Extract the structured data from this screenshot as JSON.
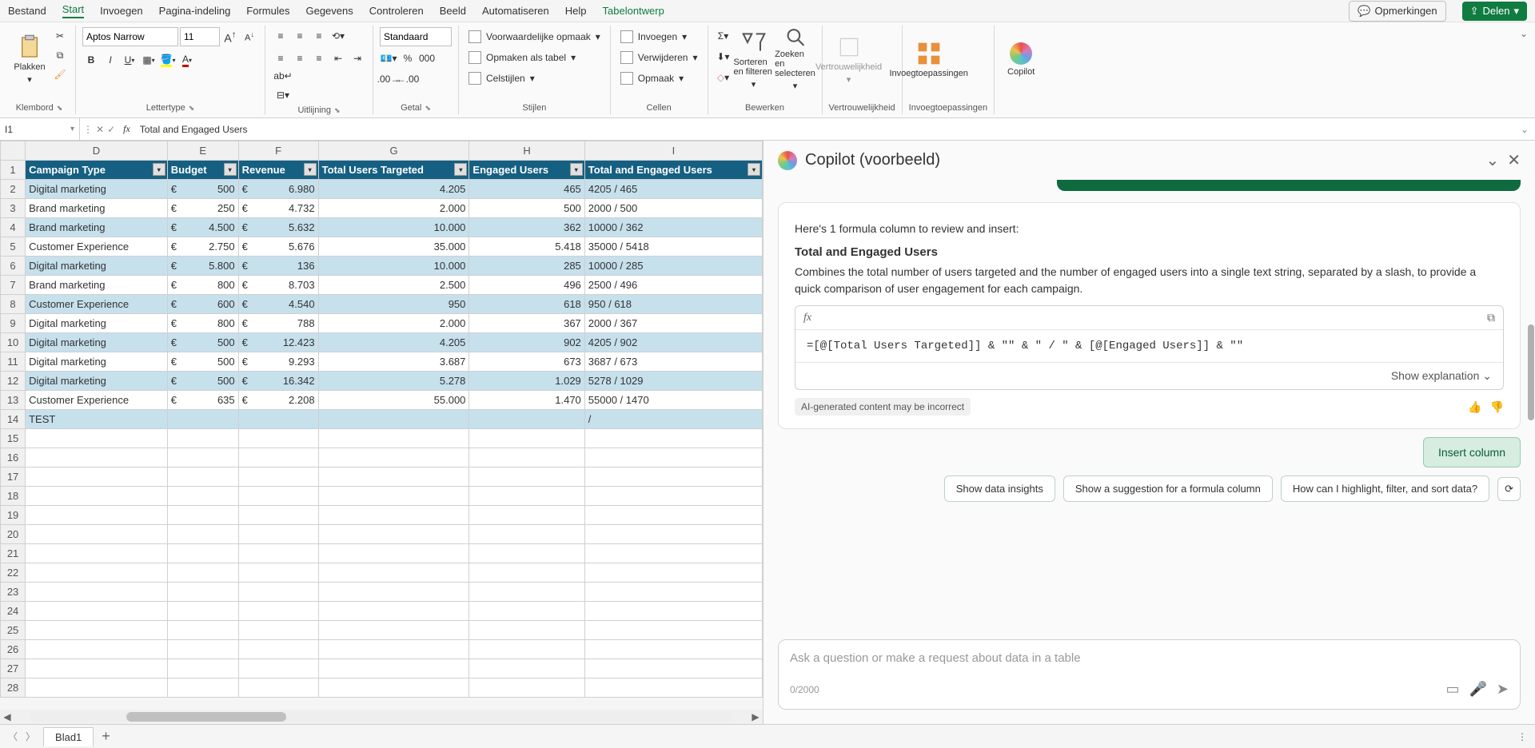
{
  "menu": [
    "Bestand",
    "Start",
    "Invoegen",
    "Pagina-indeling",
    "Formules",
    "Gegevens",
    "Controleren",
    "Beeld",
    "Automatiseren",
    "Help",
    "Tabelontwerp"
  ],
  "active_menu": 1,
  "special_menu": 10,
  "opmerkingen": "Opmerkingen",
  "delen": "Delen",
  "ribbon": {
    "plakken": "Plakken",
    "klembord": "Klembord",
    "font_name": "Aptos Narrow",
    "font_size": "11",
    "lettertype": "Lettertype",
    "uitlijning": "Uitlijning",
    "getal": "Getal",
    "num_format": "Standaard",
    "cond_fmt": "Voorwaardelijke opmaak",
    "fmt_table": "Opmaken als tabel",
    "celstijlen": "Celstijlen",
    "stijlen": "Stijlen",
    "invoegen": "Invoegen",
    "verwijderen": "Verwijderen",
    "opmaak": "Opmaak",
    "cellen": "Cellen",
    "sort_filter": "Sorteren en filteren",
    "find_select": "Zoeken en selecteren",
    "bewerken": "Bewerken",
    "vertrouw": "Vertrouwelijkheid",
    "addins": "Invoegtoepassingen",
    "copilot": "Copilot",
    "pct": "%",
    "zeros": "000"
  },
  "namebox": "I1",
  "formula": "Total and Engaged Users",
  "cols": [
    "D",
    "E",
    "F",
    "G",
    "H",
    "I"
  ],
  "headers": [
    "Campaign Type",
    "Budget",
    "Revenue",
    "Total Users Targeted",
    "Engaged Users",
    "Total and Engaged Users"
  ],
  "rows": [
    {
      "n": 2,
      "ct": "Digital marketing",
      "b": "500",
      "r": "6.980",
      "tt": "4.205",
      "eu": "465",
      "te": "4205 / 465"
    },
    {
      "n": 3,
      "ct": "Brand marketing",
      "b": "250",
      "r": "4.732",
      "tt": "2.000",
      "eu": "500",
      "te": "2000 / 500"
    },
    {
      "n": 4,
      "ct": "Brand marketing",
      "b": "4.500",
      "r": "5.632",
      "tt": "10.000",
      "eu": "362",
      "te": "10000 / 362"
    },
    {
      "n": 5,
      "ct": "Customer Experience",
      "b": "2.750",
      "r": "5.676",
      "tt": "35.000",
      "eu": "5.418",
      "te": "35000 / 5418"
    },
    {
      "n": 6,
      "ct": "Digital marketing",
      "b": "5.800",
      "r": "136",
      "tt": "10.000",
      "eu": "285",
      "te": "10000 / 285"
    },
    {
      "n": 7,
      "ct": "Brand marketing",
      "b": "800",
      "r": "8.703",
      "tt": "2.500",
      "eu": "496",
      "te": "2500 / 496"
    },
    {
      "n": 8,
      "ct": "Customer Experience",
      "b": "600",
      "r": "4.540",
      "tt": "950",
      "eu": "618",
      "te": "950 / 618"
    },
    {
      "n": 9,
      "ct": "Digital marketing",
      "b": "800",
      "r": "788",
      "tt": "2.000",
      "eu": "367",
      "te": "2000 / 367"
    },
    {
      "n": 10,
      "ct": "Digital marketing",
      "b": "500",
      "r": "12.423",
      "tt": "4.205",
      "eu": "902",
      "te": "4205 / 902"
    },
    {
      "n": 11,
      "ct": "Digital marketing",
      "b": "500",
      "r": "9.293",
      "tt": "3.687",
      "eu": "673",
      "te": "3687 / 673"
    },
    {
      "n": 12,
      "ct": "Digital marketing",
      "b": "500",
      "r": "16.342",
      "tt": "5.278",
      "eu": "1.029",
      "te": "5278 / 1029"
    },
    {
      "n": 13,
      "ct": "Customer Experience",
      "b": "635",
      "r": "2.208",
      "tt": "55.000",
      "eu": "1.470",
      "te": "55000 / 1470"
    },
    {
      "n": 14,
      "ct": "TEST",
      "b": "",
      "r": "",
      "tt": "",
      "eu": "",
      "te": "/"
    }
  ],
  "empty_rows": [
    15,
    16,
    17,
    18,
    19,
    20,
    21,
    22,
    23,
    24,
    25,
    26,
    27,
    28
  ],
  "sheet_tab": "Blad1",
  "euro": "€",
  "copilot_title": "Copilot (voorbeeld)",
  "copilot": {
    "intro": "Here's 1 formula column to review and insert:",
    "col_title": "Total and Engaged Users",
    "desc": "Combines the total number of users targeted and the number of engaged users into a single text string, separated by a slash, to provide a quick comparison of user engagement for each campaign.",
    "formula": "=[@[Total Users Targeted]] & \"\" & \" / \" & [@[Engaged Users]] & \"\"",
    "show_exp": "Show explanation",
    "ai_note": "AI-generated content may be incorrect",
    "insert": "Insert column",
    "chip1": "Show data insights",
    "chip2": "Show a suggestion for a formula column",
    "chip3": "How can I highlight, filter, and sort data?",
    "placeholder": "Ask a question or make a request about data in a table",
    "counter": "0/2000"
  }
}
